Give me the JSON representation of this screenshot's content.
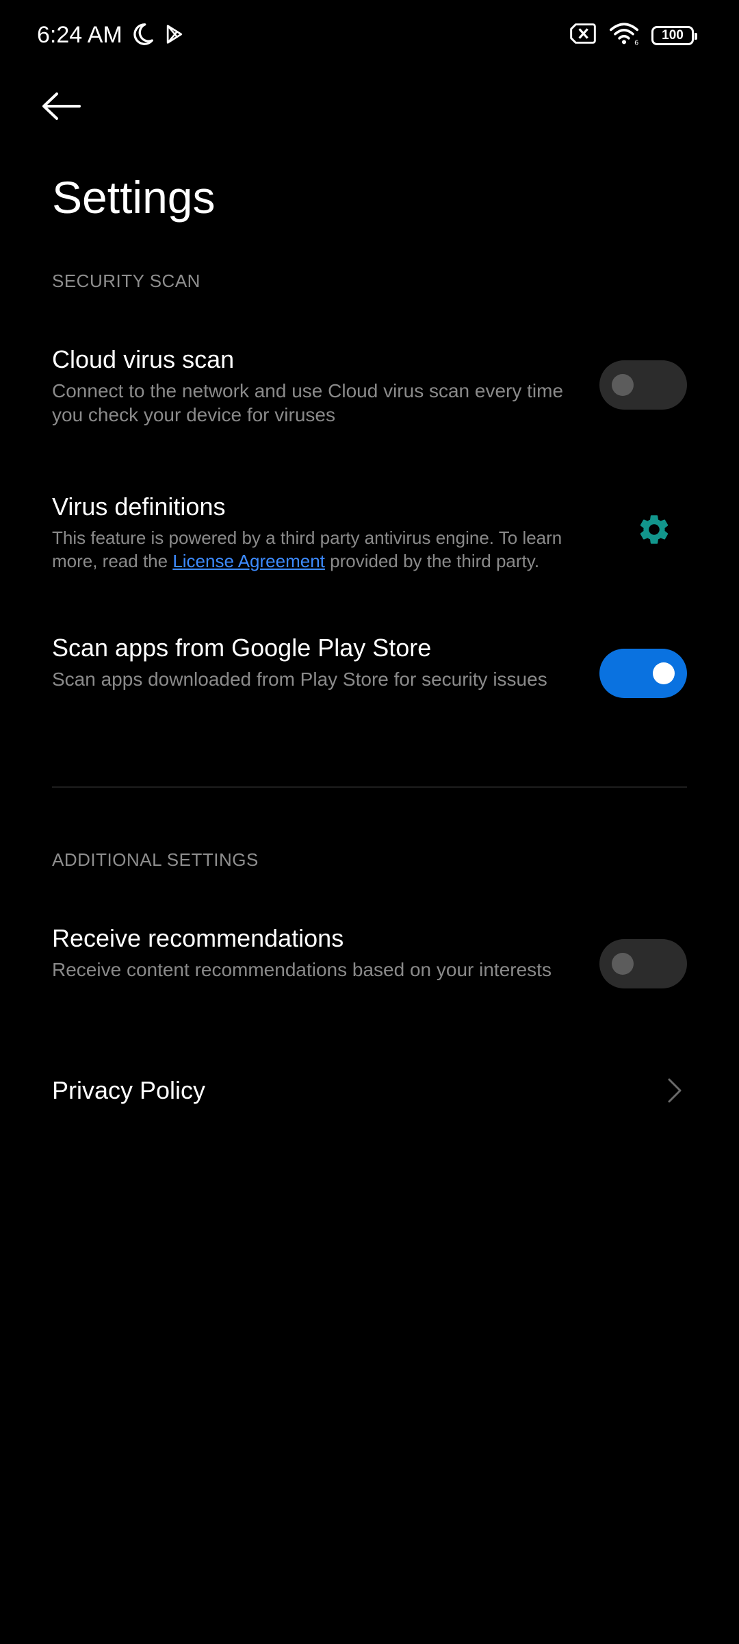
{
  "status_bar": {
    "time": "6:24 AM",
    "battery_level": "100",
    "left_icons": [
      "moon-icon",
      "play-store-icon"
    ],
    "right_icons": [
      "sim-off-icon",
      "wifi-icon",
      "battery-icon"
    ]
  },
  "header": {
    "back_icon": "arrow-left-icon",
    "title": "Settings"
  },
  "sections": {
    "security_scan": {
      "header": "SECURITY SCAN",
      "cloud_virus_scan": {
        "title": "Cloud virus scan",
        "description": "Connect to the network and use Cloud virus scan every time you check your device for viruses",
        "enabled": false
      },
      "virus_definitions": {
        "title": "Virus definitions",
        "description_before": "This feature is powered by a third party antivirus engine. To learn more, read the ",
        "link_text": "License Agreement",
        "description_after": " provided by the third party.",
        "icon": "gear-icon"
      },
      "scan_apps_play_store": {
        "title": "Scan apps from Google Play Store",
        "description": "Scan apps downloaded from Play Store for security issues",
        "enabled": true
      }
    },
    "additional_settings": {
      "header": "ADDITIONAL SETTINGS",
      "receive_recommendations": {
        "title": "Receive recommendations",
        "description": "Receive content recommendations based on your interests",
        "enabled": false
      },
      "privacy_policy": {
        "title": "Privacy Policy",
        "icon": "chevron-right-icon"
      }
    }
  },
  "colors": {
    "background": "#000000",
    "accent": "#0a72e0",
    "link": "#3d8bff",
    "gear": "#12968c",
    "secondary_text": "#8a8a8a"
  }
}
